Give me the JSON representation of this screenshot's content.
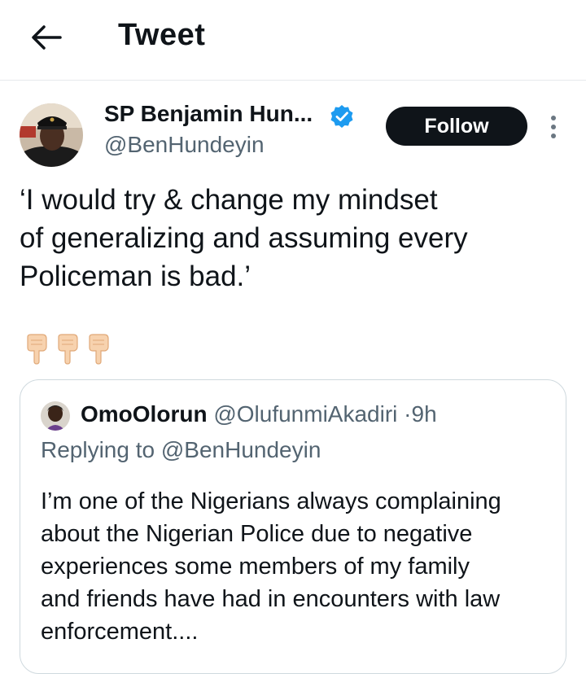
{
  "header": {
    "title": "Tweet"
  },
  "tweet": {
    "author_name": "SP Benjamin Hun...",
    "author_handle": "@BenHundeyin",
    "follow_label": "Follow",
    "text_lines": [
      "‘I would try & change my mindset",
      "of generalizing and assuming every",
      "Policeman is bad.’"
    ],
    "emojis": [
      "backhand-index-pointing-down",
      "backhand-index-pointing-down",
      "backhand-index-pointing-down"
    ]
  },
  "quoted_tweet": {
    "author_name": "OmoOlorun",
    "author_handle": "@OlufunmiAkadiri",
    "separator": "·",
    "time": "9h",
    "replying_to": "Replying to @BenHundeyin",
    "text_lines": [
      "I’m one of the Nigerians always complaining",
      "about the Nigerian Police due to negative",
      "experiences some members of my family",
      "and friends have had in encounters with law",
      "enforcement...."
    ]
  },
  "colors": {
    "text_primary": "#0f1419",
    "text_secondary": "#536471",
    "verified_blue": "#1d9bf0",
    "follow_bg": "#0f1419",
    "border": "#cfd9de"
  }
}
